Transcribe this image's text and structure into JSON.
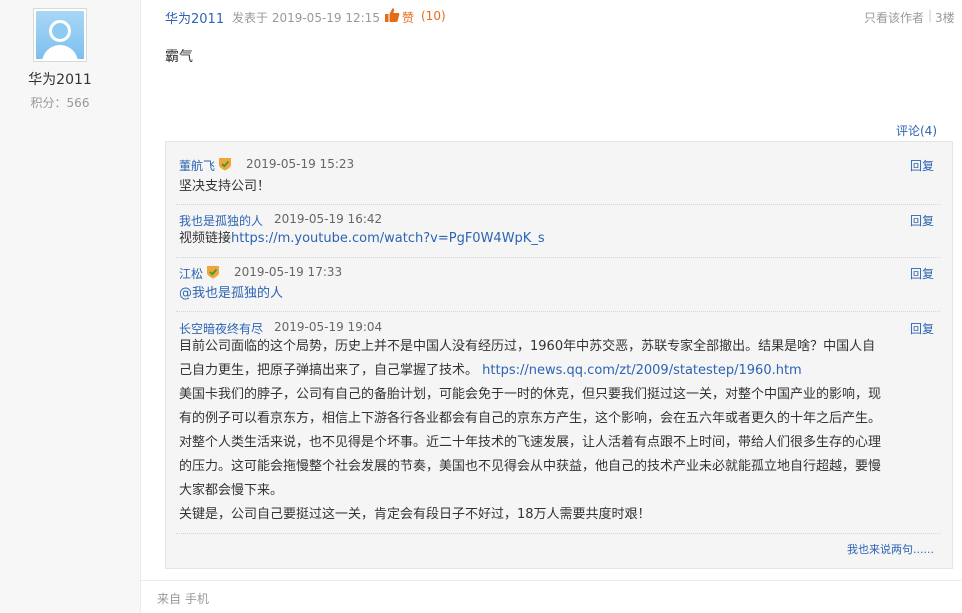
{
  "author": {
    "name": "华为2011",
    "score": "积分：566"
  },
  "post": {
    "author": "华为2011",
    "time": "发表于 2019-05-19 12:15",
    "like_label": "赞",
    "like_count": "(10)",
    "only_author": "只看该作者",
    "floor": "3楼",
    "body": "霸气",
    "comment_toggle": "评论(4)"
  },
  "comments": [
    {
      "user": "董航飞",
      "time": "2019-05-19 15:23",
      "reply": "回复",
      "text": "坚决支持公司！"
    },
    {
      "user": "我也是孤独的人",
      "time": "2019-05-19 16:42",
      "reply": "回复",
      "text_prefix": "视频链接",
      "link": "https://m.youtube.com/watch?v=PgF0W4WpK_s"
    },
    {
      "user": "江松",
      "time": "2019-05-19 17:33",
      "reply": "回复",
      "mention": "@我也是孤独的人"
    },
    {
      "user": "长空暗夜终有尽",
      "time": "2019-05-19 19:04",
      "reply": "回复",
      "lines": [
        "目前公司面临的这个局势，历史上并不是中国人没有经历过，1960年中苏交恶，苏联专家全部撤出。结果是啥？中国人自",
        "己自力更生，把原子弹搞出来了，自己掌握了技术。",
        "美国卡我们的脖子，公司有自己的备胎计划，可能会免于一时的休克，但只要我们挺过这一关，对整个中国产业的影响，现",
        "有的例子可以看京东方，相信上下游各行各业都会有自己的京东方产生，这个影响，会在五六年或者更久的十年之后产生。",
        "对整个人类生活来说，也不见得是个坏事。近二十年技术的飞速发展，让人活着有点跟不上时间，带给人们很多生存的心理",
        "的压力。这可能会拖慢整个社会发展的节奏，美国也不见得会从中获益，他自己的技术产业未必就能孤立地自行超越，要慢",
        "大家都会慢下来。",
        "关键是，公司自己要挺过这一关，肯定会有段日子不好过，18万人需要共度时艰！"
      ],
      "link": "https://news.qq.com/zt/2009/statestep/1960.htm"
    }
  ],
  "more_link": "我也来说两句......",
  "source": "来自 手机",
  "colors": {
    "link": "#2d64b3",
    "like": "#e66b1a",
    "panel": "#f5f5f5"
  },
  "icons": [
    "avatar-default-icon",
    "thumb-up-icon",
    "verified-badge-icon"
  ]
}
